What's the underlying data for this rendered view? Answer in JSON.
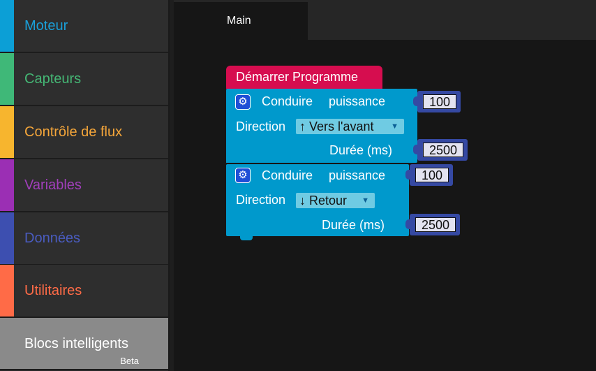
{
  "sidebar": {
    "categories": [
      {
        "label": "Moteur",
        "color": "#0c9fd6"
      },
      {
        "label": "Capteurs",
        "color": "#3fb878"
      },
      {
        "label": "Contrôle de flux",
        "color": "#f7b52e"
      },
      {
        "label": "Variables",
        "color": "#9b2fb4"
      },
      {
        "label": "Données",
        "color": "#3d4fb0"
      },
      {
        "label": "Utilitaires",
        "color": "#ff6b47"
      },
      {
        "label": "Blocs intelligents",
        "badge": "Beta"
      }
    ]
  },
  "tabs": [
    {
      "label": "Main"
    }
  ],
  "blocks": {
    "start": {
      "label": "Démarrer Programme",
      "color": "#d60d4f"
    },
    "drive1": {
      "title": "Conduire",
      "power_label": "puissance",
      "power": "100",
      "direction_label": "Direction",
      "direction": "↑ Vers l'avant",
      "duration_label": "Durée (ms)",
      "duration": "2500"
    },
    "drive2": {
      "title": "Conduire",
      "power_label": "puissance",
      "power": "100",
      "direction_label": "Direction",
      "direction": "↓ Retour",
      "duration_label": "Durée (ms)",
      "duration": "2500"
    },
    "gear_icon": "gear-icon",
    "dropdown_arrow": "▼"
  }
}
